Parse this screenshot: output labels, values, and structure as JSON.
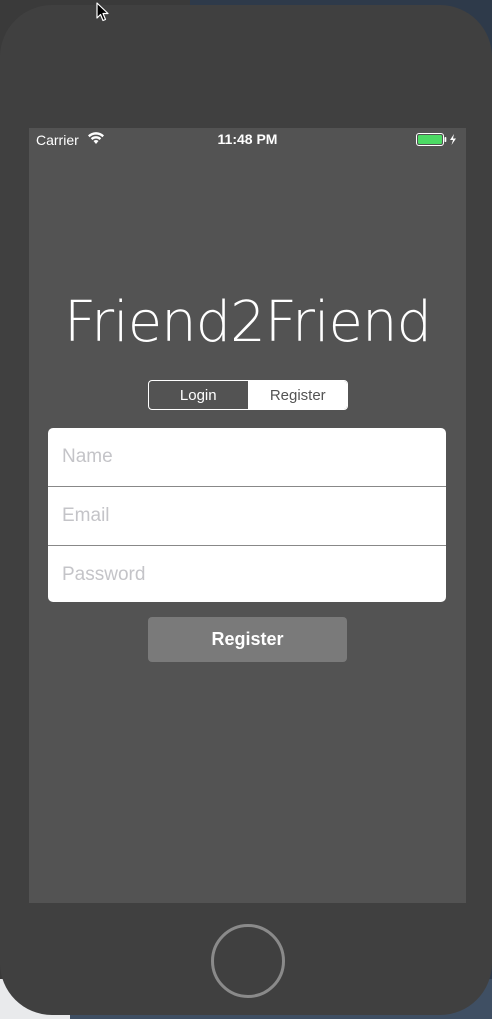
{
  "status_bar": {
    "carrier": "Carrier",
    "time": "11:48 PM",
    "wifi_icon": "wifi-icon",
    "battery_icon": "battery-charging-icon",
    "battery_color": "#4cd964"
  },
  "app": {
    "title": "Friend2Friend"
  },
  "segmented_control": {
    "options": [
      "Login",
      "Register"
    ],
    "selected": "Register"
  },
  "form": {
    "name_placeholder": "Name",
    "email_placeholder": "Email",
    "password_placeholder": "Password",
    "name_value": "",
    "email_value": "",
    "password_value": ""
  },
  "actions": {
    "register_label": "Register"
  },
  "colors": {
    "screen_background": "#535353",
    "phone_body": "#404040",
    "button_background": "#7a7a7a"
  }
}
